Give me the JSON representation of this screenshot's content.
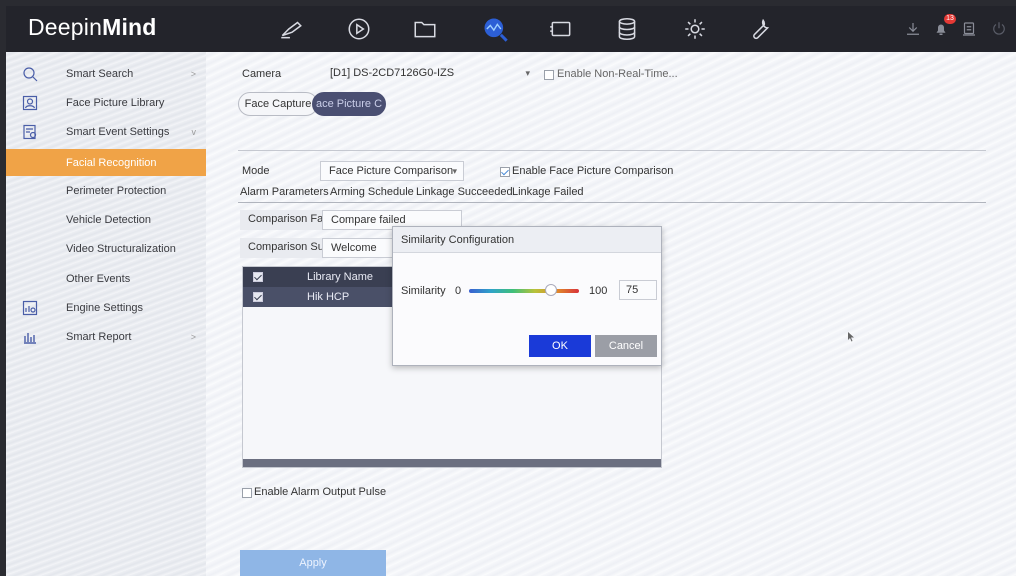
{
  "brand": {
    "part1": "Deepin",
    "part2": "Mind"
  },
  "nav_icons": [
    "camera-icon",
    "playback-icon",
    "folder-icon",
    "smart-search-icon",
    "monitor-icon",
    "storage-icon",
    "gear-icon",
    "wrench-icon"
  ],
  "top_right_icons": [
    "download-icon",
    "alarm-icon",
    "display-icon",
    "power-icon"
  ],
  "alarm_count": "13",
  "colors": {
    "accent": "#f0a347",
    "topbar": "#23242b",
    "ok": "#1a3ad8"
  },
  "sidebar": {
    "items": [
      {
        "label": "Smart Search",
        "icon": "smart-search-icon",
        "chev": ">"
      },
      {
        "label": "Face Picture Library",
        "icon": "face-library-icon"
      },
      {
        "label": "Smart Event Settings",
        "icon": "event-settings-icon",
        "chev": "v"
      },
      {
        "label": "Facial Recognition"
      },
      {
        "label": "Perimeter Protection"
      },
      {
        "label": "Vehicle Detection"
      },
      {
        "label": "Video Structuralization"
      },
      {
        "label": "Other Events"
      },
      {
        "label": "Engine Settings",
        "icon": "engine-settings-icon"
      },
      {
        "label": "Smart Report",
        "icon": "report-icon",
        "chev": ">"
      }
    ]
  },
  "camera": {
    "label": "Camera",
    "value": "[D1] DS-2CD7126G0-IZS",
    "non_realtime": "Enable Non-Real-Time..."
  },
  "capture_tabs": {
    "face_capture": "Face Capture",
    "face_picture": "ace Picture C"
  },
  "mode": {
    "label": "Mode",
    "value": "Face Picture Comparison",
    "enable": "Enable Face Picture Comparison"
  },
  "sub_tabs": [
    "Alarm Parameters",
    "Arming Schedule",
    "Linkage Succeeded",
    "Linkage Failed"
  ],
  "comparison_failed": {
    "label": "Comparison Fa...",
    "value": "Compare failed"
  },
  "comparison_success": {
    "label": "Comparison Su...",
    "value": "Welcome"
  },
  "table": {
    "header": "Library Name",
    "rows": [
      "Hik HCP"
    ]
  },
  "dialog": {
    "title": "Similarity Configuration",
    "similarity_label": "Similarity",
    "min": "0",
    "max": "100",
    "value": "75",
    "ok": "OK",
    "cancel": "Cancel"
  },
  "alarm_output": "Enable Alarm Output Pulse",
  "apply": "Apply"
}
